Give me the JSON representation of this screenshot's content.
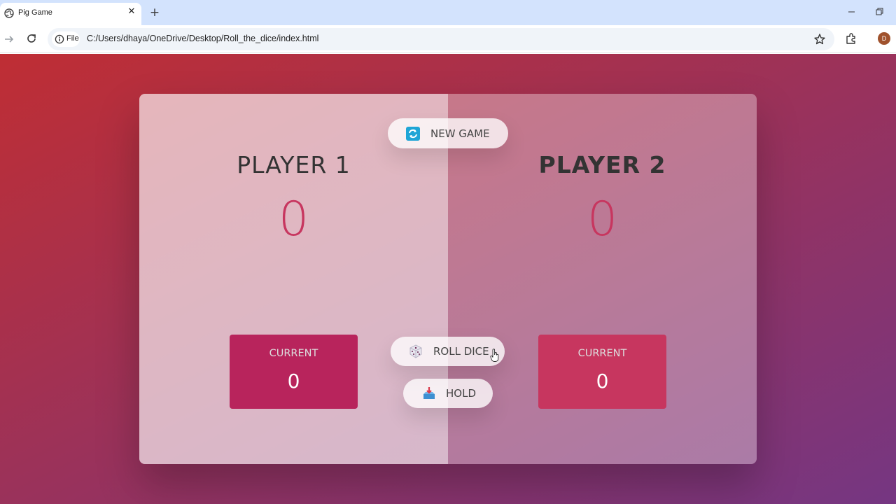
{
  "browser": {
    "tab_title": "Pig Game",
    "tab_close_glyph": "✕",
    "new_tab_glyph": "+",
    "address_chip": "File",
    "url": "C:/Users/dhaya/OneDrive/Desktop/Roll_the_dice/index.html",
    "profile_initial": "D"
  },
  "game": {
    "players": [
      {
        "name": "PLAYER 1",
        "score": "0",
        "current_label": "CURRENT",
        "current_score": "0",
        "active": true
      },
      {
        "name": "PLAYER 2",
        "score": "0",
        "current_label": "CURRENT",
        "current_score": "0",
        "active": false
      }
    ],
    "buttons": {
      "new_game": "NEW GAME",
      "roll_dice": "ROLL DICE",
      "hold": "HOLD"
    },
    "icons": {
      "new_game": "refresh-icon",
      "roll_dice": "dice-icon",
      "hold": "inbox-tray-icon"
    }
  },
  "colors": {
    "gradient_start": "#bf2e34",
    "gradient_end": "#753682",
    "score_accent": "#c7365f",
    "current_box": "#b8245c"
  }
}
